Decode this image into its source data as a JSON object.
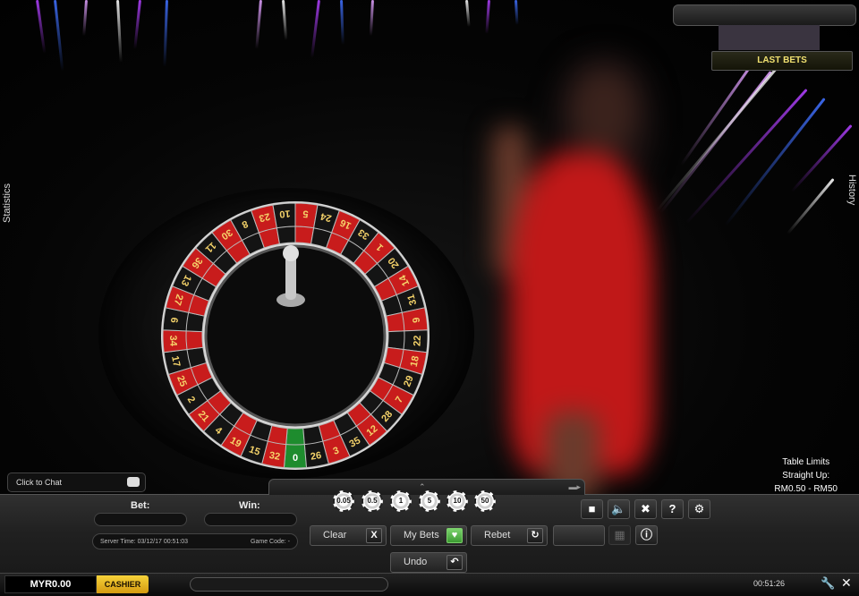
{
  "stage": {
    "statistics_tab": "Statistics",
    "history_tab": "History",
    "last_bets_label": "LAST BETS",
    "chat_placeholder": "Click to Chat"
  },
  "wheel": {
    "numbers": [
      "0",
      "32",
      "15",
      "19",
      "4",
      "21",
      "2",
      "25",
      "17",
      "34",
      "6",
      "27",
      "13",
      "36",
      "11",
      "30",
      "8",
      "23",
      "10",
      "5",
      "24",
      "16",
      "33",
      "1",
      "20",
      "14",
      "31",
      "9",
      "22",
      "18",
      "29",
      "7",
      "28",
      "12",
      "35",
      "3",
      "26"
    ],
    "colors": {
      "red": "#c81c1c",
      "black": "#141414",
      "green": "#1e8c2e"
    },
    "reds": [
      "1",
      "3",
      "5",
      "7",
      "9",
      "12",
      "14",
      "16",
      "18",
      "19",
      "21",
      "23",
      "25",
      "27",
      "30",
      "32",
      "34",
      "36"
    ]
  },
  "table_limits": {
    "title": "Table Limits",
    "subtitle": "Straight Up:",
    "range": "RM0.50 - RM50"
  },
  "chips": [
    "0.05",
    "0.5",
    "1",
    "5",
    "10",
    "50"
  ],
  "bet_panel": {
    "bet_label": "Bet:",
    "win_label": "Win:",
    "server_time": "Server Time: 03/12/17 00:51:03",
    "game_code": "Game Code: -"
  },
  "buttons": {
    "clear": "Clear",
    "my_bets": "My Bets",
    "rebet": "Rebet",
    "undo": "Undo"
  },
  "status_bar": {
    "balance": "MYR0.00",
    "cashier": "CASHIER",
    "clock": "00:51:26"
  },
  "theme": {
    "accent": "#f2c530",
    "dress": "#c01818",
    "streak_purple": "#b040ff",
    "streak_blue": "#4070ff"
  }
}
